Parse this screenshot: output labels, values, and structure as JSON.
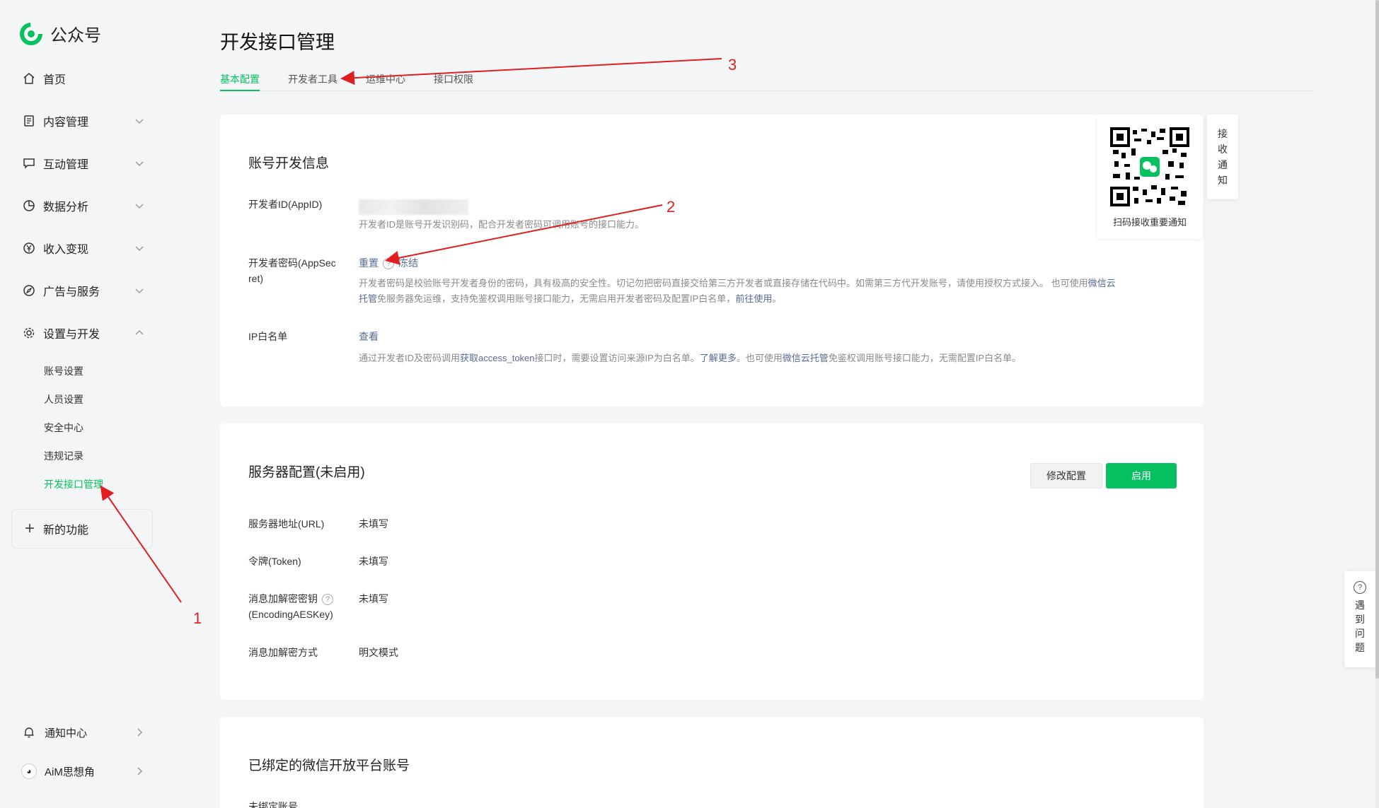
{
  "app": {
    "name": "公众号",
    "brand_color": "#07c160"
  },
  "sidebar": {
    "items": [
      {
        "label": "首页",
        "icon": "home-icon",
        "expandable": false
      },
      {
        "label": "内容管理",
        "icon": "document-icon",
        "expandable": true
      },
      {
        "label": "互动管理",
        "icon": "chat-icon",
        "expandable": true
      },
      {
        "label": "数据分析",
        "icon": "pie-chart-icon",
        "expandable": true
      },
      {
        "label": "收入变现",
        "icon": "yen-icon",
        "expandable": true
      },
      {
        "label": "广告与服务",
        "icon": "compass-icon",
        "expandable": true
      },
      {
        "label": "设置与开发",
        "icon": "gear-icon",
        "expandable": true,
        "expanded": true
      }
    ],
    "sub_items": [
      "账号设置",
      "人员设置",
      "安全中心",
      "违规记录",
      "开发接口管理"
    ],
    "active_sub": "开发接口管理",
    "new_feature": "新的功能",
    "notification": "通知中心",
    "account": "AiM思想角"
  },
  "page": {
    "title": "开发接口管理",
    "tabs": [
      "基本配置",
      "开发者工具",
      "运维中心",
      "接口权限"
    ],
    "active_tab": "基本配置"
  },
  "dev_info": {
    "title": "账号开发信息",
    "appid_label": "开发者ID(AppID)",
    "appid_desc": "开发者ID是账号开发识别码，配合开发者密码可调用账号的接口能力。",
    "secret_label_1": "开发者密码(AppSec",
    "secret_label_2": "ret)",
    "secret_reset": "重置",
    "secret_help": "?",
    "secret_freeze": "冻结",
    "secret_desc_1a": "开发者密码是校验账号开发者身份的密码，具有极高的安全性。切记勿把密码直接交给第三方开发者或直接存储在代码中。如需第三方代开发账号，请使用授权方式接入。 也可使用",
    "secret_desc_1b": "微信云",
    "secret_desc_2a": "托管",
    "secret_desc_2b": "免服务器免运维，支持免鉴权调用账号接口能力，无需启用开发者密码及配置IP白名单，",
    "secret_desc_2c": "前往使用",
    "secret_desc_2d": "。",
    "ip_label": "IP白名单",
    "ip_view": "查看",
    "ip_desc_a": "通过开发者ID及密码调用",
    "ip_desc_b": "获取access_token",
    "ip_desc_c": "接口时，需要设置访问来源IP为白名单。",
    "ip_desc_d": "了解更多",
    "ip_desc_e": "。也可使用",
    "ip_desc_f": "微信云托管",
    "ip_desc_g": "免鉴权调用账号接口能力，无需配置IP白名单。"
  },
  "qr": {
    "caption": "扫码接收重要通知",
    "side_label": [
      "接",
      "收",
      "通",
      "知"
    ]
  },
  "server": {
    "title": "服务器配置(未启用)",
    "modify_button": "修改配置",
    "enable_button": "启用",
    "url_label": "服务器地址(URL)",
    "url_value": "未填写",
    "token_label": "令牌(Token)",
    "token_value": "未填写",
    "aes_label_1": "消息加解密密钥",
    "aes_help": "?",
    "aes_label_2": "(EncodingAESKey)",
    "aes_value": "未填写",
    "mode_label": "消息加解密方式",
    "mode_value": "明文模式"
  },
  "open_platform": {
    "title": "已绑定的微信开放平台账号",
    "status": "未绑定账号"
  },
  "help_side": {
    "icon_text": "?",
    "label": [
      "遇",
      "到",
      "问",
      "题"
    ]
  },
  "annotations": {
    "n1": "1",
    "n2": "2",
    "n3": "3",
    "color": "#e02020"
  }
}
